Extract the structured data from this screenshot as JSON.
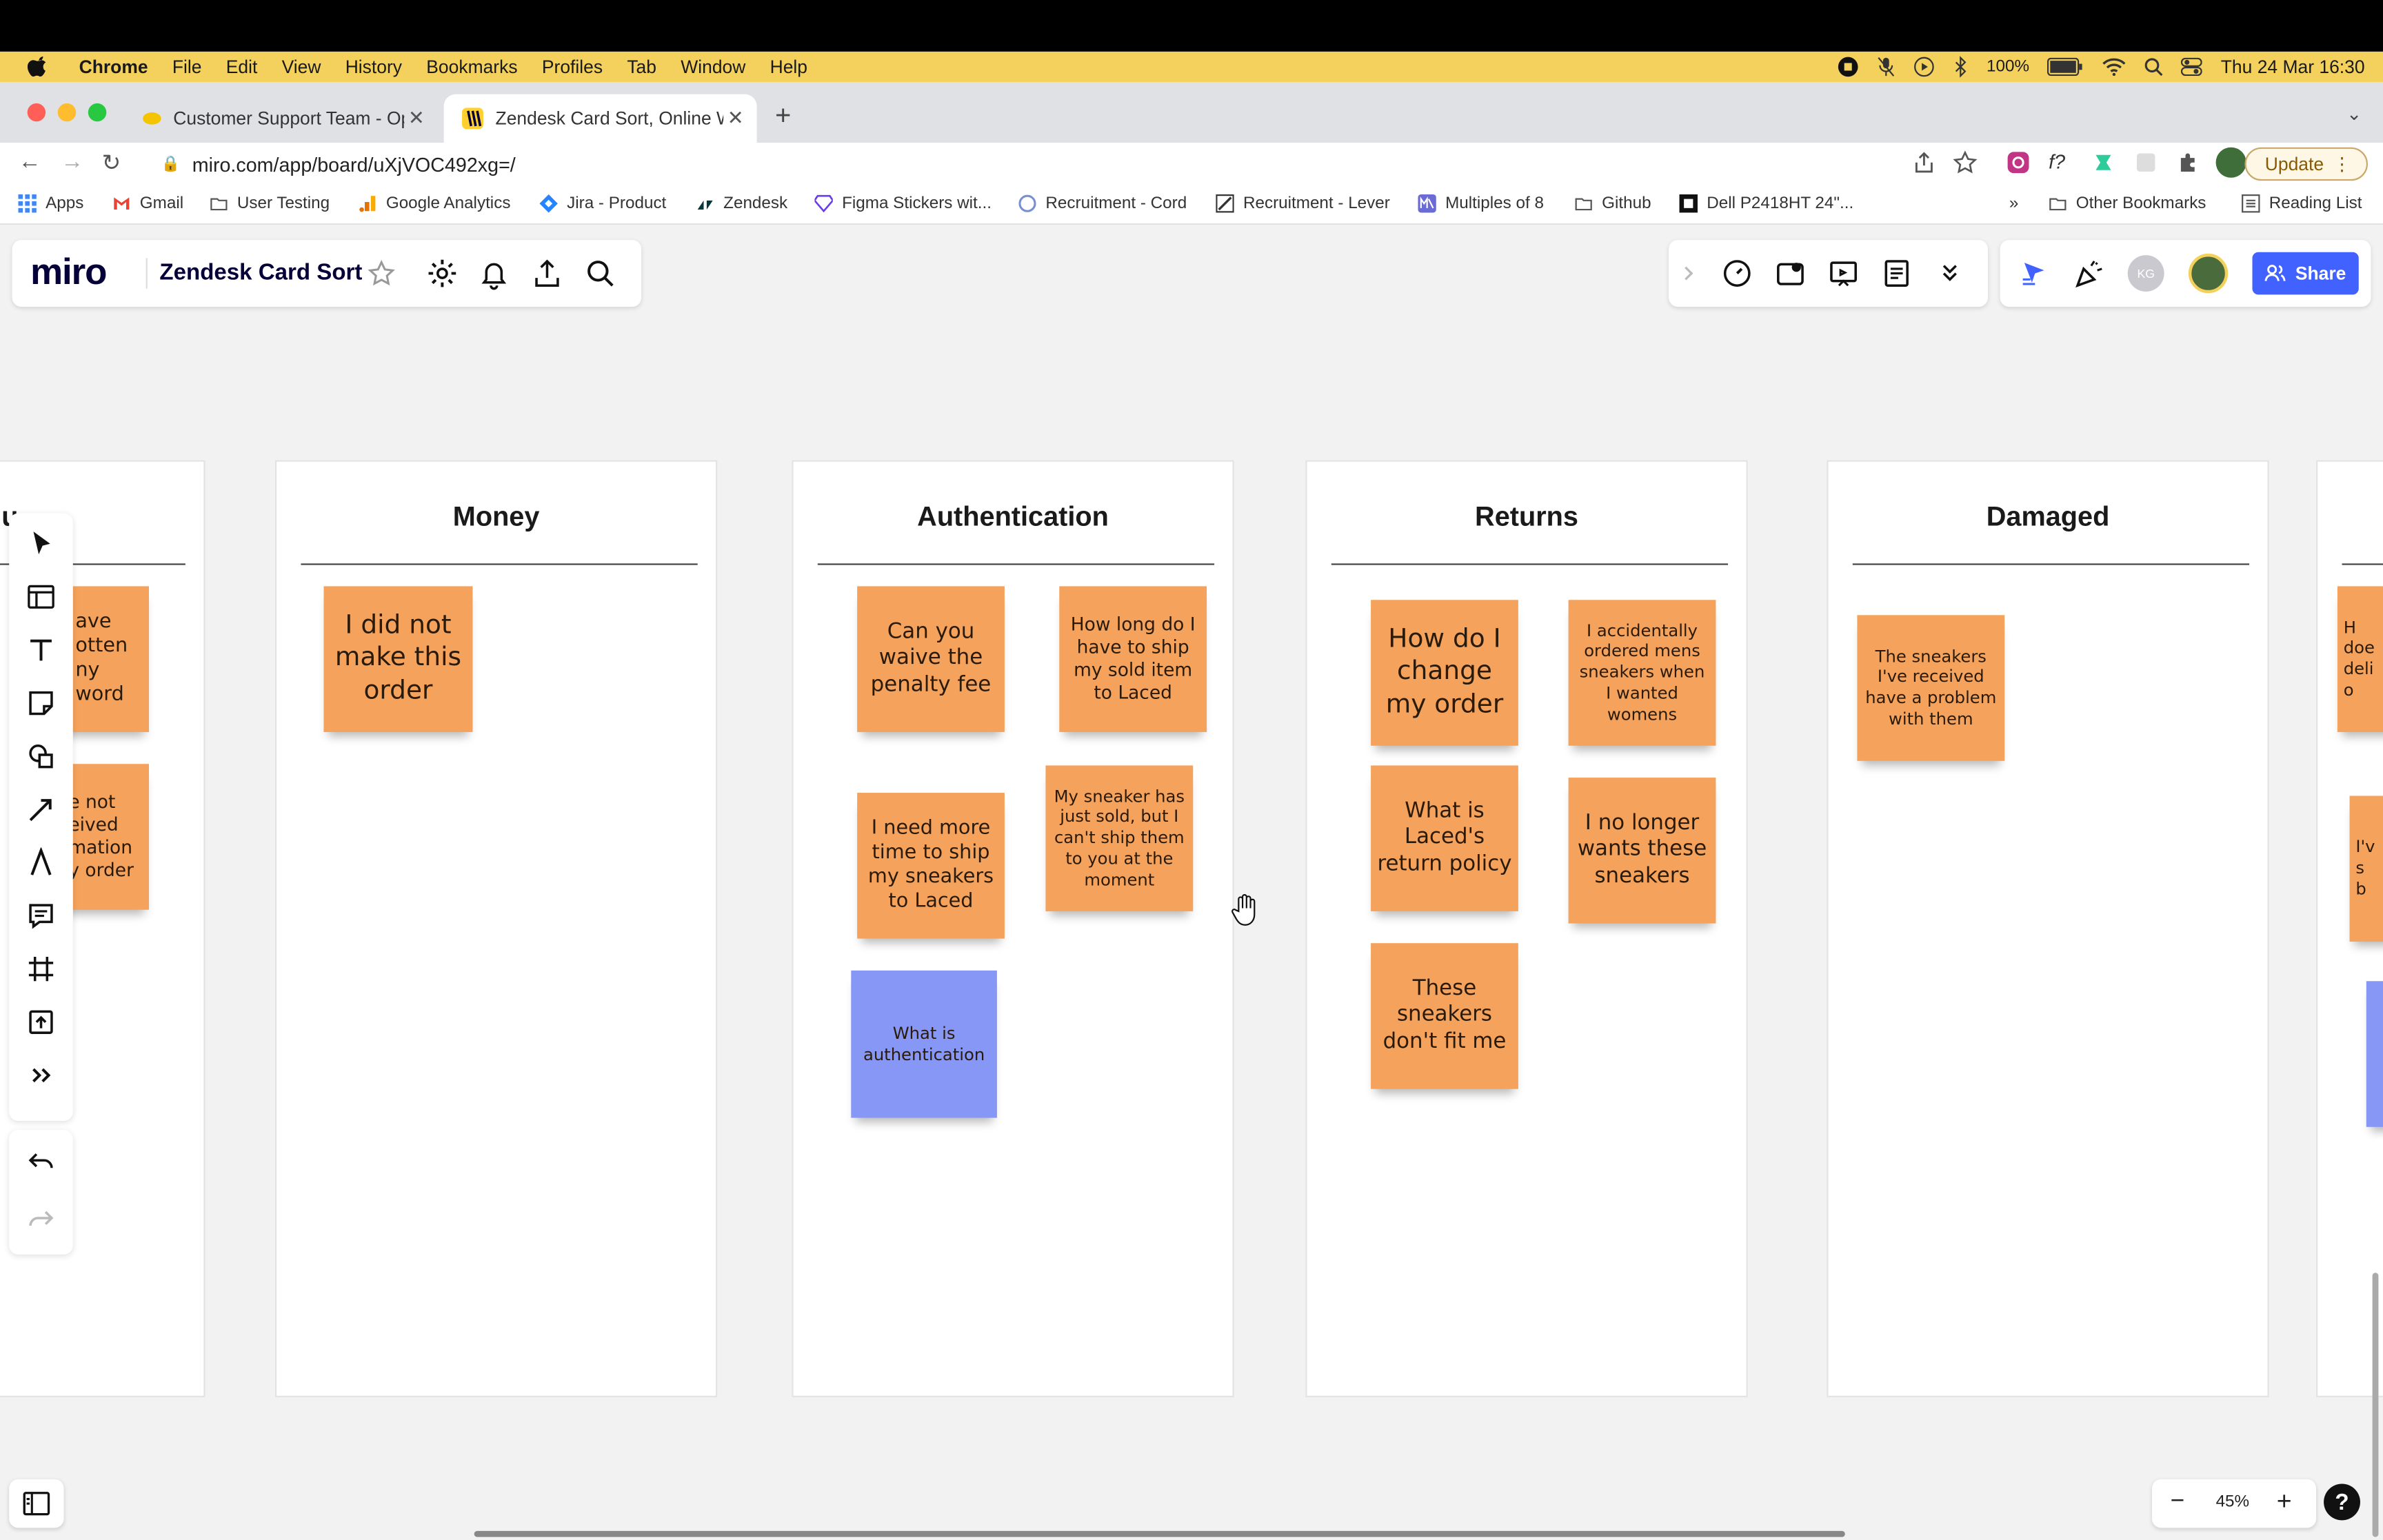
{
  "menubar": {
    "app_name": "Chrome",
    "items": [
      "File",
      "Edit",
      "View",
      "History",
      "Bookmarks",
      "Profiles",
      "Tab",
      "Window",
      "Help"
    ],
    "battery": "100%",
    "datetime": "Thu 24 Mar  16:30"
  },
  "tabs": [
    {
      "title": "Customer Support Team - Ope",
      "active": false
    },
    {
      "title": "Zendesk Card Sort, Online Wh",
      "active": true
    }
  ],
  "address_bar": {
    "url": "miro.com/app/board/uXjVOC492xg=/",
    "update_label": "Update"
  },
  "bookmarks": {
    "items": [
      "Apps",
      "Gmail",
      "User Testing",
      "Google Analytics",
      "Jira - Product",
      "Zendesk",
      "Figma Stickers wit...",
      "Recruitment - Cord",
      "Recruitment - Lever",
      "Multiples of 8",
      "Github",
      "Dell P2418HT 24\"..."
    ],
    "more": "»",
    "other": "Other Bookmarks",
    "reading_list": "Reading List"
  },
  "miro": {
    "logo": "miro",
    "board_title": "Zendesk Card Sort",
    "share_label": "Share",
    "user_initials": "KG",
    "zoom_level": "45%",
    "help": "?"
  },
  "frames": [
    {
      "title": "u",
      "stickies": [
        {
          "text": "ave\notten\nny\nword",
          "color": "orange"
        },
        {
          "text": "e not\neived\nmation\ny order",
          "color": "orange"
        }
      ]
    },
    {
      "title": "Money",
      "stickies": [
        {
          "text": "I did not make this order",
          "color": "orange"
        }
      ]
    },
    {
      "title": "Authentication",
      "stickies": [
        {
          "text": "Can you waive the penalty fee",
          "color": "orange"
        },
        {
          "text": "How long do I have to ship my sold item to Laced",
          "color": "orange"
        },
        {
          "text": "I need more time to ship my sneakers to Laced",
          "color": "orange"
        },
        {
          "text": "My sneaker has just sold, but I can't ship them to you at the moment",
          "color": "orange"
        },
        {
          "text": "What is authentication",
          "color": "blue"
        }
      ]
    },
    {
      "title": "Returns",
      "stickies": [
        {
          "text": "How do I change my order",
          "color": "orange"
        },
        {
          "text": "I accidentally ordered mens sneakers when I wanted womens",
          "color": "orange"
        },
        {
          "text": "What is Laced's return policy",
          "color": "orange"
        },
        {
          "text": "I no longer wants these sneakers",
          "color": "orange"
        },
        {
          "text": "These sneakers don't fit me",
          "color": "orange"
        }
      ]
    },
    {
      "title": "Damaged",
      "stickies": [
        {
          "text": "The sneakers I've received have a problem with them",
          "color": "orange"
        }
      ]
    },
    {
      "title": "",
      "stickies": [
        {
          "text": "H\ndoe\ndeli\no",
          "color": "orange"
        },
        {
          "text": "I'v\ns\nb",
          "color": "orange"
        }
      ]
    }
  ],
  "colors": {
    "sticky_orange": "#f5a35c",
    "sticky_blue": "#8797f5",
    "share_blue": "#4262ff",
    "menubar_yellow": "#f4d15d"
  }
}
